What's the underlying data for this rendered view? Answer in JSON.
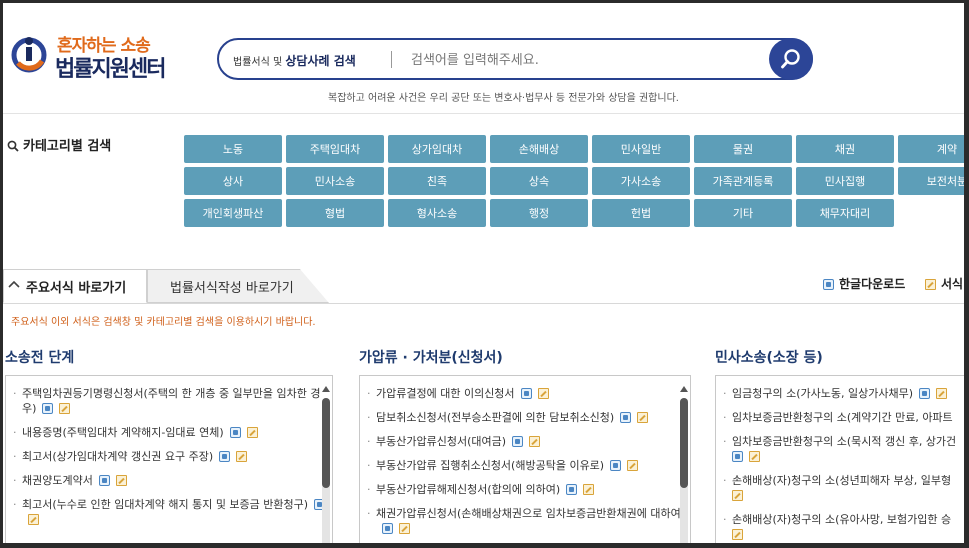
{
  "brand": {
    "tagline": "혼자하는 소송",
    "name": "법률지원센터"
  },
  "search": {
    "scope_prefix": "법률서식 및",
    "scope_bold": "상담사례 검색",
    "placeholder": "검색어를 입력해주세요.",
    "icon": "search-icon",
    "note": "복잡하고 어려운 사건은 우리 공단 또는 변호사·법무사 등 전문가와 상담을 권합니다."
  },
  "category": {
    "title": "카테고리별 검색",
    "rows": [
      [
        "노동",
        "주택임대차",
        "상가임대차",
        "손해배상",
        "민사일반",
        "물권",
        "채권",
        "계약"
      ],
      [
        "상사",
        "민사소송",
        "친족",
        "상속",
        "가사소송",
        "가족관계등록",
        "민사집행",
        "보전처분"
      ],
      [
        "개인회생파산",
        "형법",
        "형사소송",
        "행정",
        "헌법",
        "기타",
        "채무자대리"
      ]
    ]
  },
  "tabs": {
    "active": "주요서식 바로가기",
    "inactive": "법률서식작성 바로가기",
    "download_hwp": "한글다운로드",
    "download_write": "서식"
  },
  "notice": "주요서식 이외 서식은 검색창 및 카테고리별 검색을 이용하시기 바랍니다.",
  "columns": [
    {
      "title": "소송전 단계",
      "items": [
        "주택임차권등기명령신청서(주택의 한 개층 중 일부만을 임차한 경우)",
        "내용증명(주택임대차 계약해지-임대료 연체)",
        "최고서(상가임대차계약 갱신권 요구 주장)",
        "채권양도계약서",
        "최고서(누수로 인한 임대차계약 해지 통지 및 보증금 반환청구)"
      ]
    },
    {
      "title": "가압류 · 가처분(신청서)",
      "items": [
        "가압류결정에 대한 이의신청서",
        "담보취소신청서(전부승소판결에 의한 담보취소신청)",
        "부동산가압류신청서(대여금)",
        "부동산가압류 집행취소신청서(해방공탁을 이유로)",
        "부동산가압류해제신청서(합의에 의하여)",
        "채권가압류신청서(손해배상채권으로 임차보증금반환채권에 대하여)"
      ]
    },
    {
      "title": "민사소송(소장 등)",
      "items": [
        "임금청구의 소(가사노동, 일상가사채무)",
        "임차보증금반환청구의 소(계약기간 만료, 아파트",
        "임차보증금반환청구의 소(묵시적 갱신 후, 상가건",
        "손해배상(자)청구의 소(성년피해자 부상, 일부형",
        "손해배상(자)청구의 소(유아사망, 보험가입한 승"
      ]
    }
  ]
}
